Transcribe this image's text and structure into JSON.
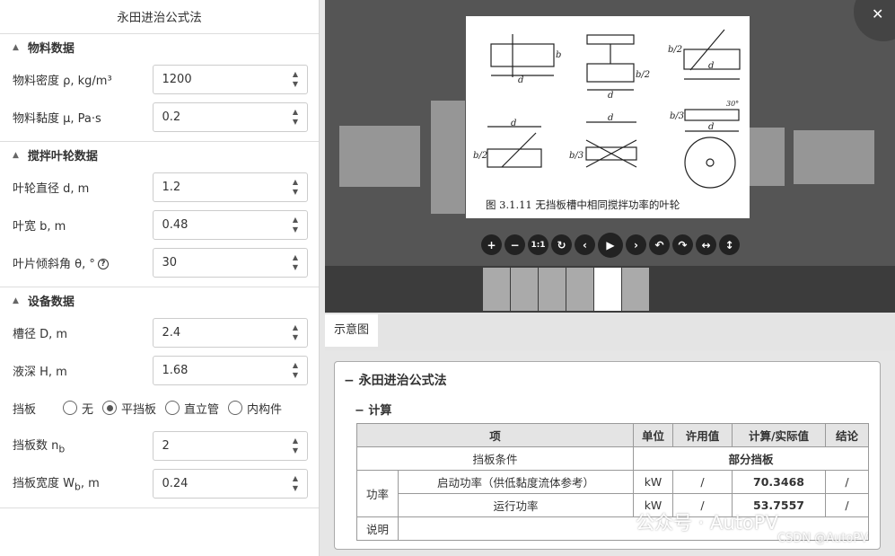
{
  "left_panel": {
    "title": "永田进治公式法",
    "sections": [
      {
        "title": "物料数据",
        "fields": [
          {
            "label": "物料密度 ρ, kg/m³",
            "value": "1200"
          },
          {
            "label": "物料黏度 μ, Pa·s",
            "value": "0.2"
          }
        ]
      },
      {
        "title": "搅拌叶轮数据",
        "fields": [
          {
            "label": "叶轮直径 d, m",
            "value": "1.2"
          },
          {
            "label": "叶宽 b, m",
            "value": "0.48"
          },
          {
            "label": "叶片倾斜角 θ, °",
            "value": "30"
          }
        ]
      },
      {
        "title": "设备数据",
        "fields": [
          {
            "label": "槽径 D, m",
            "value": "2.4"
          },
          {
            "label": "液深 H, m",
            "value": "1.68"
          }
        ],
        "baffle": {
          "label": "挡板",
          "options": [
            "无",
            "平挡板",
            "直立管",
            "内构件"
          ],
          "selected": "平挡板"
        },
        "fields2": [
          {
            "label": "挡板数 n",
            "sub": "b",
            "value": "2"
          },
          {
            "label": "挡板宽度 W",
            "sub": "b",
            "suffix": ", m",
            "value": "0.24"
          }
        ]
      }
    ],
    "help_glyph": "?",
    "collapse_glyph": "▲",
    "up_arrow": "▲",
    "down_arrow": "▼"
  },
  "viewer": {
    "caption": "图 3.1.11  无挡板槽中相同搅拌功率的叶轮",
    "dim_d": "d",
    "dim_b": "b",
    "dim_b2": "b/2",
    "dim_b3": "b/3",
    "dim_30": "30°",
    "close_glyph": "✕",
    "toolbar": [
      "+",
      "−",
      "1:1",
      "↻",
      "‹",
      "▶",
      "›",
      "↶",
      "↷",
      "↔",
      "↕"
    ]
  },
  "tab": {
    "label": "示意图"
  },
  "result": {
    "title": "− 永田进治公式法",
    "sub": "− 计算",
    "headers": [
      "项",
      "单位",
      "许用值",
      "计算/实际值",
      "结论"
    ],
    "baffle_row": {
      "label": "挡板条件",
      "value": "部分挡板"
    },
    "power_label": "功率",
    "rows": [
      {
        "name": "启动功率（供低黏度流体参考）",
        "unit": "kW",
        "allow": "/",
        "value": "70.3468",
        "verdict": "/"
      },
      {
        "name": "运行功率",
        "unit": "kW",
        "allow": "/",
        "value": "53.7557",
        "verdict": "/"
      }
    ],
    "note_label": "说明"
  },
  "watermark": {
    "brand": "公众号 · AutoPV",
    "csdn": "CSDN @AutoPV"
  }
}
